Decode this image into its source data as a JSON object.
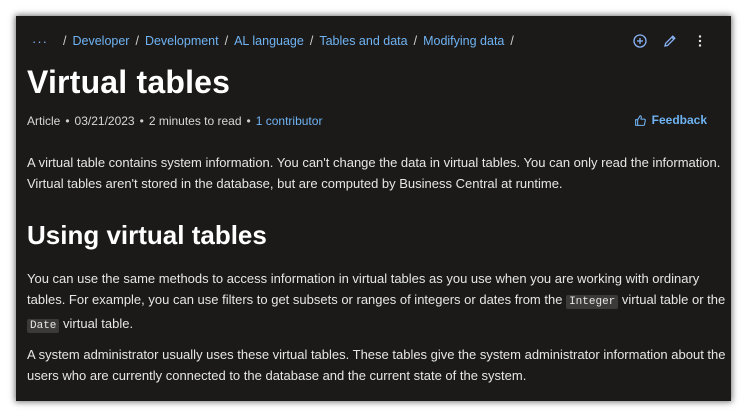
{
  "breadcrumb": {
    "more": "···",
    "items": [
      "Developer",
      "Development",
      "AL language",
      "Tables and data",
      "Modifying data"
    ]
  },
  "actions": [
    "add-circle-icon",
    "pencil-icon",
    "more-vertical-icon"
  ],
  "article": {
    "title": "Virtual tables",
    "meta": {
      "type": "Article",
      "date": "03/21/2023",
      "read_time": "2 minutes to read",
      "contributors": "1 contributor"
    },
    "feedback_label": "Feedback",
    "intro": "A virtual table contains system information. You can't change the data in virtual tables. You can only read the information. Virtual tables aren't stored in the database, but are computed by Business Central at runtime.",
    "section_heading": "Using virtual tables",
    "p2": {
      "a": "You can use the same methods to access information in virtual tables as you use when you are working with ordinary tables. For example, you can use filters to get subsets or ranges of integers or dates from the ",
      "code1": "Integer",
      "b": " virtual table or the ",
      "code2": "Date",
      "c": " virtual table."
    },
    "p3": "A system administrator usually uses these virtual tables. These tables give the system administrator information about the users who are currently connected to the database and the current state of the system."
  },
  "colors": {
    "background": "#1b1a19",
    "link": "#6fb3f2",
    "text": "#e6e6e6",
    "heading": "#ffffff"
  }
}
